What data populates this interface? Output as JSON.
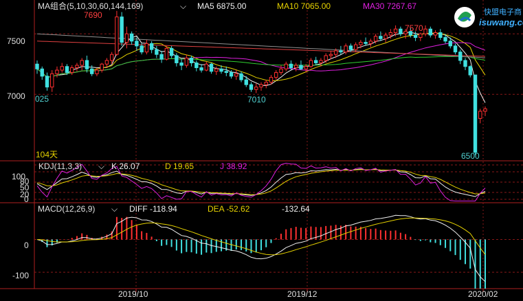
{
  "chart_data": [
    {
      "type": "candlestick",
      "panel": "price",
      "indicator_label": "MA组合(5,10,30,60,144,169)",
      "legend": [
        {
          "name": "MA5",
          "value": "6875.00",
          "color": "#f0f0f0"
        },
        {
          "name": "MA10",
          "value": "7065.00",
          "color": "#e6d200"
        },
        {
          "name": "MA30",
          "value": "7267.67",
          "color": "#e020e0"
        }
      ],
      "y_ticks": [
        "7500",
        "7000"
      ],
      "ylim": [
        6450,
        7780
      ],
      "annotations": [
        {
          "text": "7690",
          "note": "high"
        },
        {
          "text": "7570",
          "note": "high"
        },
        {
          "text": "7010",
          "note": "low"
        },
        {
          "text": "6500",
          "note": "low"
        },
        {
          "text": "025",
          "note": "cut-off label"
        },
        {
          "text": "104天",
          "note": "period count"
        }
      ],
      "candles": [
        [
          7250,
          7280,
          7170,
          7210
        ],
        [
          7210,
          7230,
          7120,
          7150
        ],
        [
          7150,
          7180,
          7030,
          7060
        ],
        [
          7060,
          7200,
          7020,
          7170
        ],
        [
          7170,
          7230,
          7140,
          7200
        ],
        [
          7200,
          7260,
          7180,
          7230
        ],
        [
          7230,
          7250,
          7160,
          7180
        ],
        [
          7180,
          7240,
          7160,
          7220
        ],
        [
          7220,
          7260,
          7190,
          7240
        ],
        [
          7240,
          7300,
          7200,
          7280
        ],
        [
          7280,
          7320,
          7180,
          7210
        ],
        [
          7210,
          7240,
          7150,
          7170
        ],
        [
          7170,
          7220,
          7150,
          7200
        ],
        [
          7200,
          7260,
          7180,
          7250
        ],
        [
          7250,
          7300,
          7220,
          7280
        ],
        [
          7280,
          7350,
          7250,
          7330
        ],
        [
          7330,
          7690,
          7320,
          7640
        ],
        [
          7640,
          7680,
          7400,
          7430
        ],
        [
          7430,
          7560,
          7380,
          7500
        ],
        [
          7500,
          7520,
          7410,
          7440
        ],
        [
          7440,
          7470,
          7360,
          7400
        ],
        [
          7400,
          7420,
          7330,
          7350
        ],
        [
          7350,
          7450,
          7330,
          7420
        ],
        [
          7420,
          7440,
          7340,
          7370
        ],
        [
          7370,
          7400,
          7300,
          7330
        ],
        [
          7330,
          7360,
          7260,
          7290
        ],
        [
          7290,
          7400,
          7280,
          7380
        ],
        [
          7380,
          7400,
          7300,
          7320
        ],
        [
          7320,
          7340,
          7230,
          7260
        ],
        [
          7260,
          7290,
          7200,
          7240
        ],
        [
          7240,
          7330,
          7220,
          7300
        ],
        [
          7300,
          7320,
          7230,
          7260
        ],
        [
          7260,
          7280,
          7190,
          7220
        ],
        [
          7220,
          7250,
          7180,
          7200
        ],
        [
          7200,
          7270,
          7190,
          7250
        ],
        [
          7250,
          7260,
          7170,
          7190
        ],
        [
          7190,
          7230,
          7160,
          7210
        ],
        [
          7210,
          7240,
          7170,
          7190
        ],
        [
          7190,
          7230,
          7150,
          7180
        ],
        [
          7180,
          7200,
          7130,
          7150
        ],
        [
          7150,
          7200,
          7120,
          7170
        ],
        [
          7170,
          7190,
          7100,
          7120
        ],
        [
          7120,
          7150,
          7060,
          7080
        ],
        [
          7080,
          7100,
          7020,
          7040
        ],
        [
          7040,
          7090,
          7010,
          7060
        ],
        [
          7060,
          7100,
          7030,
          7080
        ],
        [
          7080,
          7120,
          7050,
          7100
        ],
        [
          7100,
          7160,
          7080,
          7140
        ],
        [
          7140,
          7200,
          7120,
          7180
        ],
        [
          7180,
          7240,
          7160,
          7210
        ],
        [
          7210,
          7270,
          7190,
          7250
        ],
        [
          7250,
          7280,
          7200,
          7220
        ],
        [
          7220,
          7260,
          7190,
          7240
        ],
        [
          7240,
          7280,
          7200,
          7210
        ],
        [
          7210,
          7250,
          7180,
          7230
        ],
        [
          7230,
          7300,
          7220,
          7280
        ],
        [
          7280,
          7310,
          7240,
          7260
        ],
        [
          7260,
          7300,
          7230,
          7280
        ],
        [
          7280,
          7340,
          7260,
          7320
        ],
        [
          7320,
          7360,
          7290,
          7330
        ],
        [
          7330,
          7380,
          7300,
          7360
        ],
        [
          7360,
          7400,
          7330,
          7350
        ],
        [
          7350,
          7420,
          7330,
          7400
        ],
        [
          7400,
          7420,
          7350,
          7370
        ],
        [
          7370,
          7430,
          7350,
          7410
        ],
        [
          7410,
          7450,
          7380,
          7430
        ],
        [
          7430,
          7470,
          7400,
          7420
        ],
        [
          7420,
          7460,
          7390,
          7440
        ],
        [
          7440,
          7500,
          7420,
          7480
        ],
        [
          7480,
          7520,
          7440,
          7460
        ],
        [
          7460,
          7510,
          7430,
          7490
        ],
        [
          7490,
          7540,
          7460,
          7510
        ],
        [
          7510,
          7570,
          7480,
          7540
        ],
        [
          7540,
          7560,
          7480,
          7500
        ],
        [
          7500,
          7540,
          7460,
          7520
        ],
        [
          7520,
          7550,
          7470,
          7490
        ],
        [
          7490,
          7520,
          7440,
          7470
        ],
        [
          7470,
          7510,
          7440,
          7500
        ],
        [
          7500,
          7570,
          7480,
          7540
        ],
        [
          7540,
          7560,
          7470,
          7490
        ],
        [
          7490,
          7530,
          7460,
          7510
        ],
        [
          7510,
          7540,
          7450,
          7470
        ],
        [
          7470,
          7500,
          7420,
          7440
        ],
        [
          7440,
          7470,
          7380,
          7400
        ],
        [
          7400,
          7420,
          7330,
          7350
        ],
        [
          7350,
          7370,
          7250,
          7280
        ],
        [
          7280,
          7300,
          7200,
          7230
        ],
        [
          7230,
          7240,
          7140,
          7160
        ],
        [
          7160,
          6800,
          6500,
          6520
        ],
        [
          6800,
          6880,
          6760,
          6860
        ],
        [
          6860,
          6900,
          6820,
          6880
        ]
      ]
    },
    {
      "type": "line",
      "panel": "kdj",
      "indicator_label": "KDJ(11,3,3)",
      "legend": [
        {
          "name": "K",
          "value": "26.07",
          "color": "#f0f0f0"
        },
        {
          "name": "D",
          "value": "19.65",
          "color": "#e6d200"
        },
        {
          "name": "J",
          "value": "38.92",
          "color": "#e020e0"
        }
      ],
      "y_ticks": [
        "100",
        "80",
        "50",
        "20",
        "0"
      ],
      "ylim": [
        -10,
        110
      ]
    },
    {
      "type": "bar",
      "panel": "macd",
      "indicator_label": "MACD(12,26,9)",
      "legend": [
        {
          "name": "DIFF",
          "value": "-118.94",
          "color": "#f0f0f0"
        },
        {
          "name": "DEA",
          "value": "-52.62",
          "color": "#e6d200"
        },
        {
          "name": "",
          "value": "-132.64",
          "color": "#f0f0f0"
        }
      ],
      "y_ticks": [
        "0",
        "-100"
      ],
      "ylim": [
        -150,
        110
      ]
    }
  ],
  "x_axis": {
    "labels": [
      "2019/10",
      "2019/12",
      "2020/02"
    ]
  },
  "logo": {
    "cn": "快盟电子商",
    "en": "isuwang.com"
  }
}
